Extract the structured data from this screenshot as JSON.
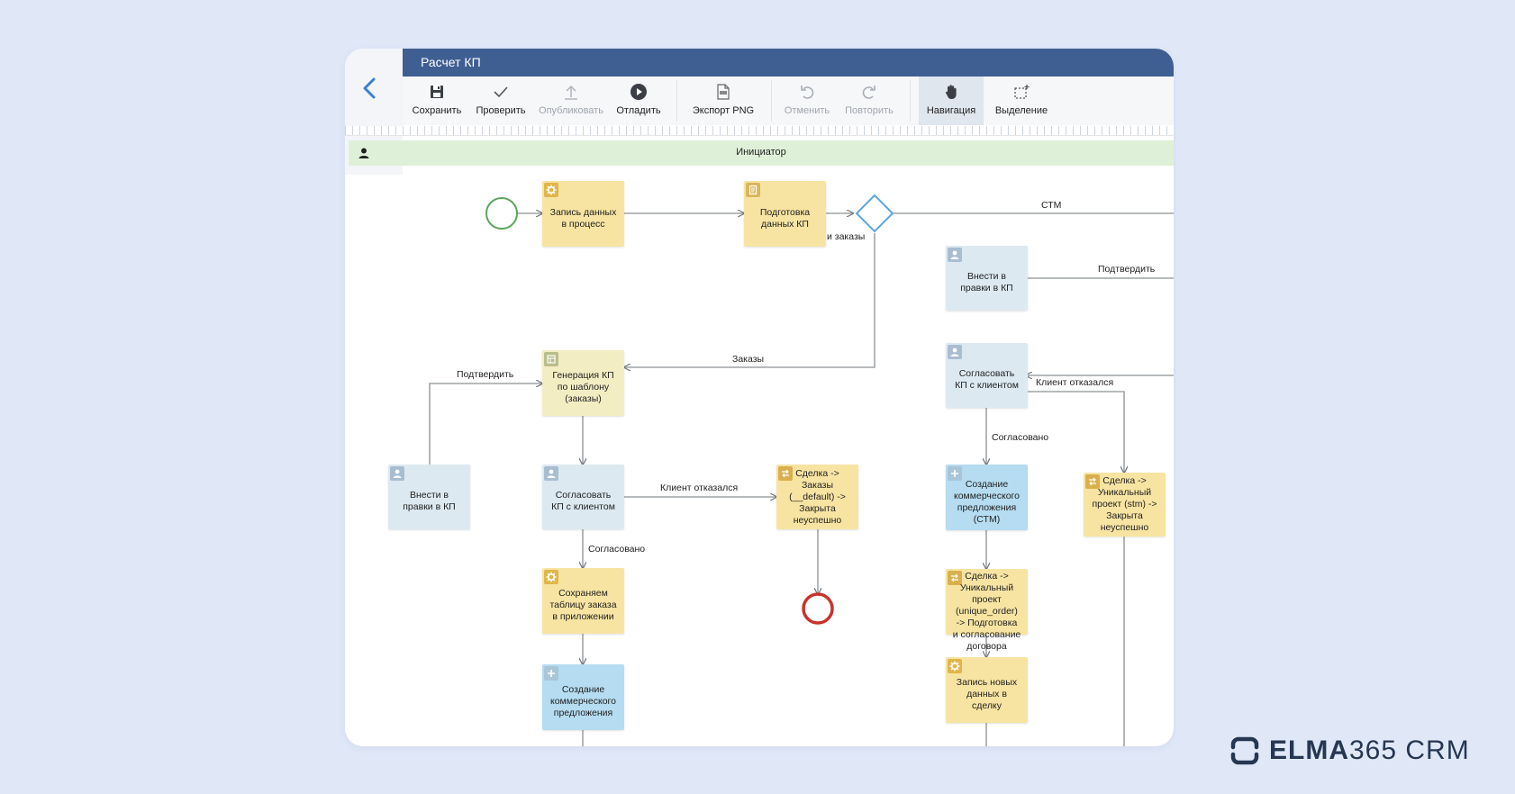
{
  "window": {
    "title": "Расчет КП"
  },
  "toolbar": {
    "save": "Сохранить",
    "check": "Проверить",
    "publish": "Опубликовать",
    "debug": "Отладить",
    "export": "Экспорт PNG",
    "undo": "Отменить",
    "redo": "Повторить",
    "navigation": "Навигация",
    "selection": "Выделение"
  },
  "lane": {
    "title": "Инициатор"
  },
  "nodes": {
    "write_data": "Запись данных\nв процесс",
    "prepare_kp": "Подготовка\nданных КП",
    "generate_kp": "Генерация КП\nпо шаблону\n(заказы)",
    "edit_left": "Внести в\nправки в КП",
    "agree_left": "Согласовать\nКП с клиентом",
    "deal_orders": "Сделка ->\nЗаказы\n(__default) ->\nЗакрыта\nнеуспешно",
    "save_table": "Сохраняем\nтаблицу заказа\nв приложении",
    "create_offer_left": "Создание\nкоммерческого\nпредложения",
    "edit_right": "Внести в\nправки в КП",
    "agree_right": "Согласовать\nКП с клиентом",
    "create_offer_stm": "Создание\nкоммерческого\nпредложения\n(СТМ)",
    "deal_unique_stm": "Сделка ->\nУникальный\nпроект (stm) ->\nЗакрыта\nнеуспешно",
    "deal_unique_order": "Сделка ->\nУникальный\nпроект\n(unique_order)\n-> Подготовка\nи согласование\nдоговора",
    "write_new": "Запись новых\nданных в\nсделку"
  },
  "edges": {
    "stm": "СТМ",
    "orders_partial": "и заказы",
    "orders": "Заказы",
    "confirm_left": "Подтвердить",
    "client_refused_left": "Клиент отказался",
    "agreed_left": "Согласовано",
    "confirm_right": "Подтвердить",
    "client_refused_right": "Клиент отказался",
    "agreed_right": "Согласовано"
  },
  "brand": {
    "bold": "ELMA",
    "rest": "365 CRM"
  },
  "colors": {
    "titlebar": "#3f5f92",
    "lane": "#dff0d8",
    "task_yellow": "#f7e4a2",
    "task_blue": "#b5dcf1",
    "task_lightblue": "#dce9f1",
    "start_event": "#5aa55a",
    "end_event": "#c9322b",
    "gateway": "#5aa7e0"
  }
}
